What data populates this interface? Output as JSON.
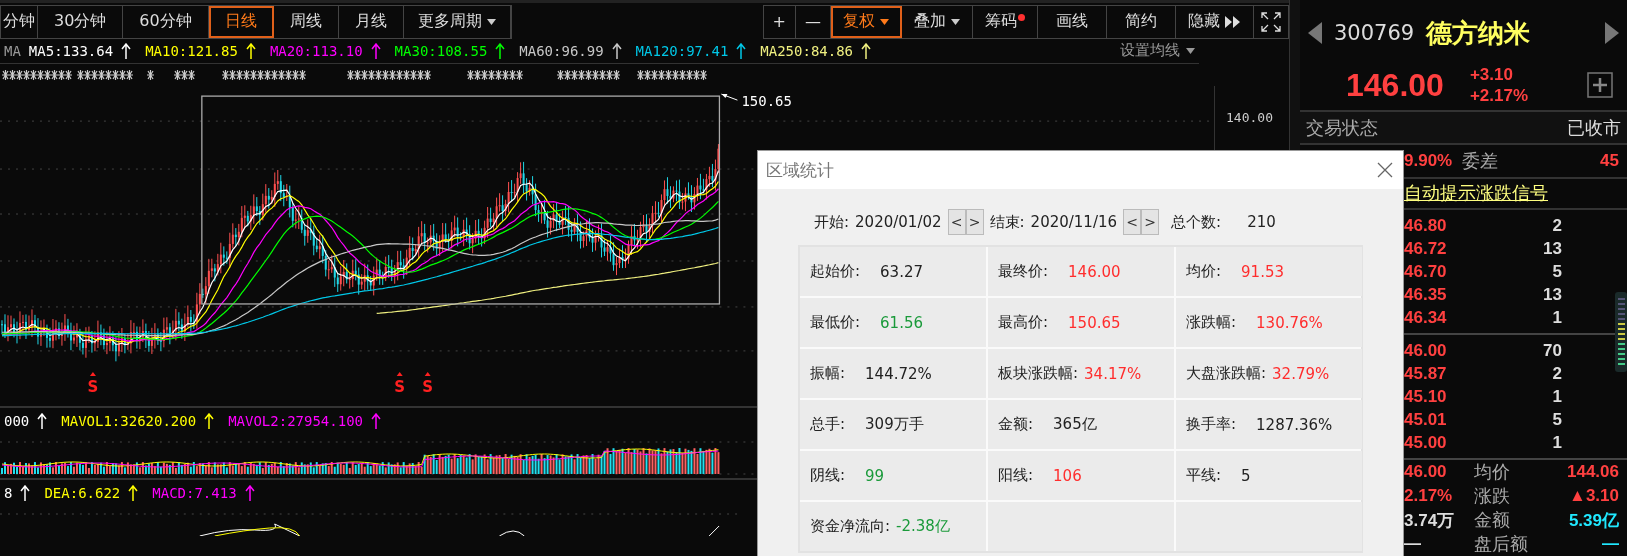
{
  "toolbar": {
    "periods": [
      {
        "label": "分钟",
        "selected": false,
        "kind": "plain"
      },
      {
        "label": "30分钟",
        "selected": false,
        "kind": "plain"
      },
      {
        "label": "60分钟",
        "selected": false,
        "kind": "plain"
      },
      {
        "label": "日线",
        "selected": true,
        "kind": "plain"
      },
      {
        "label": "周线",
        "selected": false,
        "kind": "plain"
      },
      {
        "label": "月线",
        "selected": false,
        "kind": "plain"
      },
      {
        "label": "更多周期",
        "selected": false,
        "kind": "dropdown"
      }
    ],
    "tools": [
      {
        "label": "+",
        "selected": false,
        "kind": "plain"
      },
      {
        "label": "—",
        "selected": false,
        "kind": "plain"
      },
      {
        "label": "复权",
        "selected": true,
        "kind": "dropdown"
      },
      {
        "label": "叠加",
        "selected": false,
        "kind": "dropdown"
      },
      {
        "label": "筹码",
        "selected": false,
        "kind": "dot"
      },
      {
        "label": "画线",
        "selected": false,
        "kind": "plain"
      },
      {
        "label": "简约",
        "selected": false,
        "kind": "plain"
      },
      {
        "label": "隐藏",
        "selected": false,
        "kind": "more"
      }
    ]
  },
  "ma_legend": {
    "label": "MA",
    "items": [
      {
        "text": "MA5:133.64",
        "color": "#ffffff"
      },
      {
        "text": "MA10:121.85",
        "color": "#ffff00"
      },
      {
        "text": "MA20:113.10",
        "color": "#ff00ff"
      },
      {
        "text": "MA30:108.55",
        "color": "#00ff00"
      },
      {
        "text": "MA60:96.99",
        "color": "#c8c8c8"
      },
      {
        "text": "MA120:97.41",
        "color": "#00c8e8"
      },
      {
        "text": "MA250:84.86",
        "color": "#f0f080"
      }
    ],
    "settings": "设置均线"
  },
  "price_chart": {
    "axis_label": "140.00",
    "peak_label": "150.65",
    "signals": [
      "S",
      "S",
      "S"
    ]
  },
  "volume_legend": {
    "items": [
      {
        "text": "000",
        "color": "#ffffff"
      },
      {
        "text": "MAVOL1:32620.200",
        "color": "#ffff00"
      },
      {
        "text": "MAVOL2:27954.100",
        "color": "#ff00ff"
      }
    ]
  },
  "macd_legend": {
    "items": [
      {
        "text": "8",
        "color": "#ffffff"
      },
      {
        "text": "DEA:6.622",
        "color": "#ffff00"
      },
      {
        "text": "MACD:7.413",
        "color": "#ff00ff"
      }
    ]
  },
  "quote": {
    "code": "300769",
    "name": "德方纳米",
    "price": "146.00",
    "change": "+3.10",
    "change_pct": "+2.17%",
    "status_label": "交易状态",
    "status": "已收市",
    "ratio": "9.90%",
    "diff_label": "委差",
    "diff": "45",
    "signal_link": "自动提示涨跌信号",
    "sells": [
      {
        "price": "46.80",
        "volume": "2"
      },
      {
        "price": "46.72",
        "volume": "13"
      },
      {
        "price": "46.70",
        "volume": "5"
      },
      {
        "price": "46.35",
        "volume": "13"
      },
      {
        "price": "46.34",
        "volume": "1"
      }
    ],
    "buys": [
      {
        "price": "46.00",
        "volume": "70"
      },
      {
        "price": "45.87",
        "volume": "2"
      },
      {
        "price": "45.10",
        "volume": "1"
      },
      {
        "price": "45.01",
        "volume": "5"
      },
      {
        "price": "45.00",
        "volume": "1"
      }
    ],
    "stats": [
      {
        "value": "46.00",
        "color": "#ff4040",
        "label": "均价",
        "figure": {
          "text": "144.06",
          "color": "#ff4040"
        }
      },
      {
        "value": "2.17%",
        "color": "#ff4040",
        "label": "涨跌",
        "figure": {
          "text": "▲3.10",
          "color": "#ff4040"
        }
      },
      {
        "value": "3.74万",
        "color": "#dddddd",
        "label": "金额",
        "figure": {
          "text": "5.39亿",
          "color": "#20e8ff"
        }
      },
      {
        "value": "—",
        "color": "#dddddd",
        "label": "盘后额",
        "figure": {
          "text": "—",
          "color": "#20e8ff"
        }
      }
    ]
  },
  "dialog": {
    "title": "区域统计",
    "start_label": "开始:",
    "start": "2020/01/02",
    "end_label": "结束:",
    "end": "2020/11/16",
    "prev": "<",
    "next": ">",
    "count_label": "总个数:",
    "count": "210",
    "rows": [
      [
        {
          "label": "起始价:",
          "value": "63.27",
          "color": "#222222"
        },
        {
          "label": "最终价:",
          "value": "146.00",
          "color": "#ff2d2d"
        },
        {
          "label": "均价:",
          "value": "91.53",
          "color": "#ff2d2d"
        }
      ],
      [
        {
          "label": "最低价:",
          "value": "61.56",
          "color": "#1a9a3a"
        },
        {
          "label": "最高价:",
          "value": "150.65",
          "color": "#ff2d2d"
        },
        {
          "label": "涨跌幅:",
          "value": "130.76%",
          "color": "#ff2d2d"
        }
      ],
      [
        {
          "label": "振幅:",
          "value": "144.72%",
          "color": "#222222"
        },
        {
          "label": "板块涨跌幅:",
          "value": "34.17%",
          "color": "#ff2d2d"
        },
        {
          "label": "大盘涨跌幅:",
          "value": "32.79%",
          "color": "#ff2d2d"
        }
      ],
      [
        {
          "label": "总手:",
          "value": "309万手",
          "color": "#222222"
        },
        {
          "label": "金额:",
          "value": "365亿",
          "color": "#222222"
        },
        {
          "label": "换手率:",
          "value": "1287.36%",
          "color": "#222222"
        }
      ],
      [
        {
          "label": "阴线:",
          "value": "99",
          "color": "#1a9a3a"
        },
        {
          "label": "阳线:",
          "value": "106",
          "color": "#ff2d2d"
        },
        {
          "label": "平线:",
          "value": "5",
          "color": "#222222"
        }
      ],
      [
        {
          "label": "资金净流向:",
          "value": "-2.38亿",
          "color": "#1a9a3a"
        }
      ]
    ]
  }
}
